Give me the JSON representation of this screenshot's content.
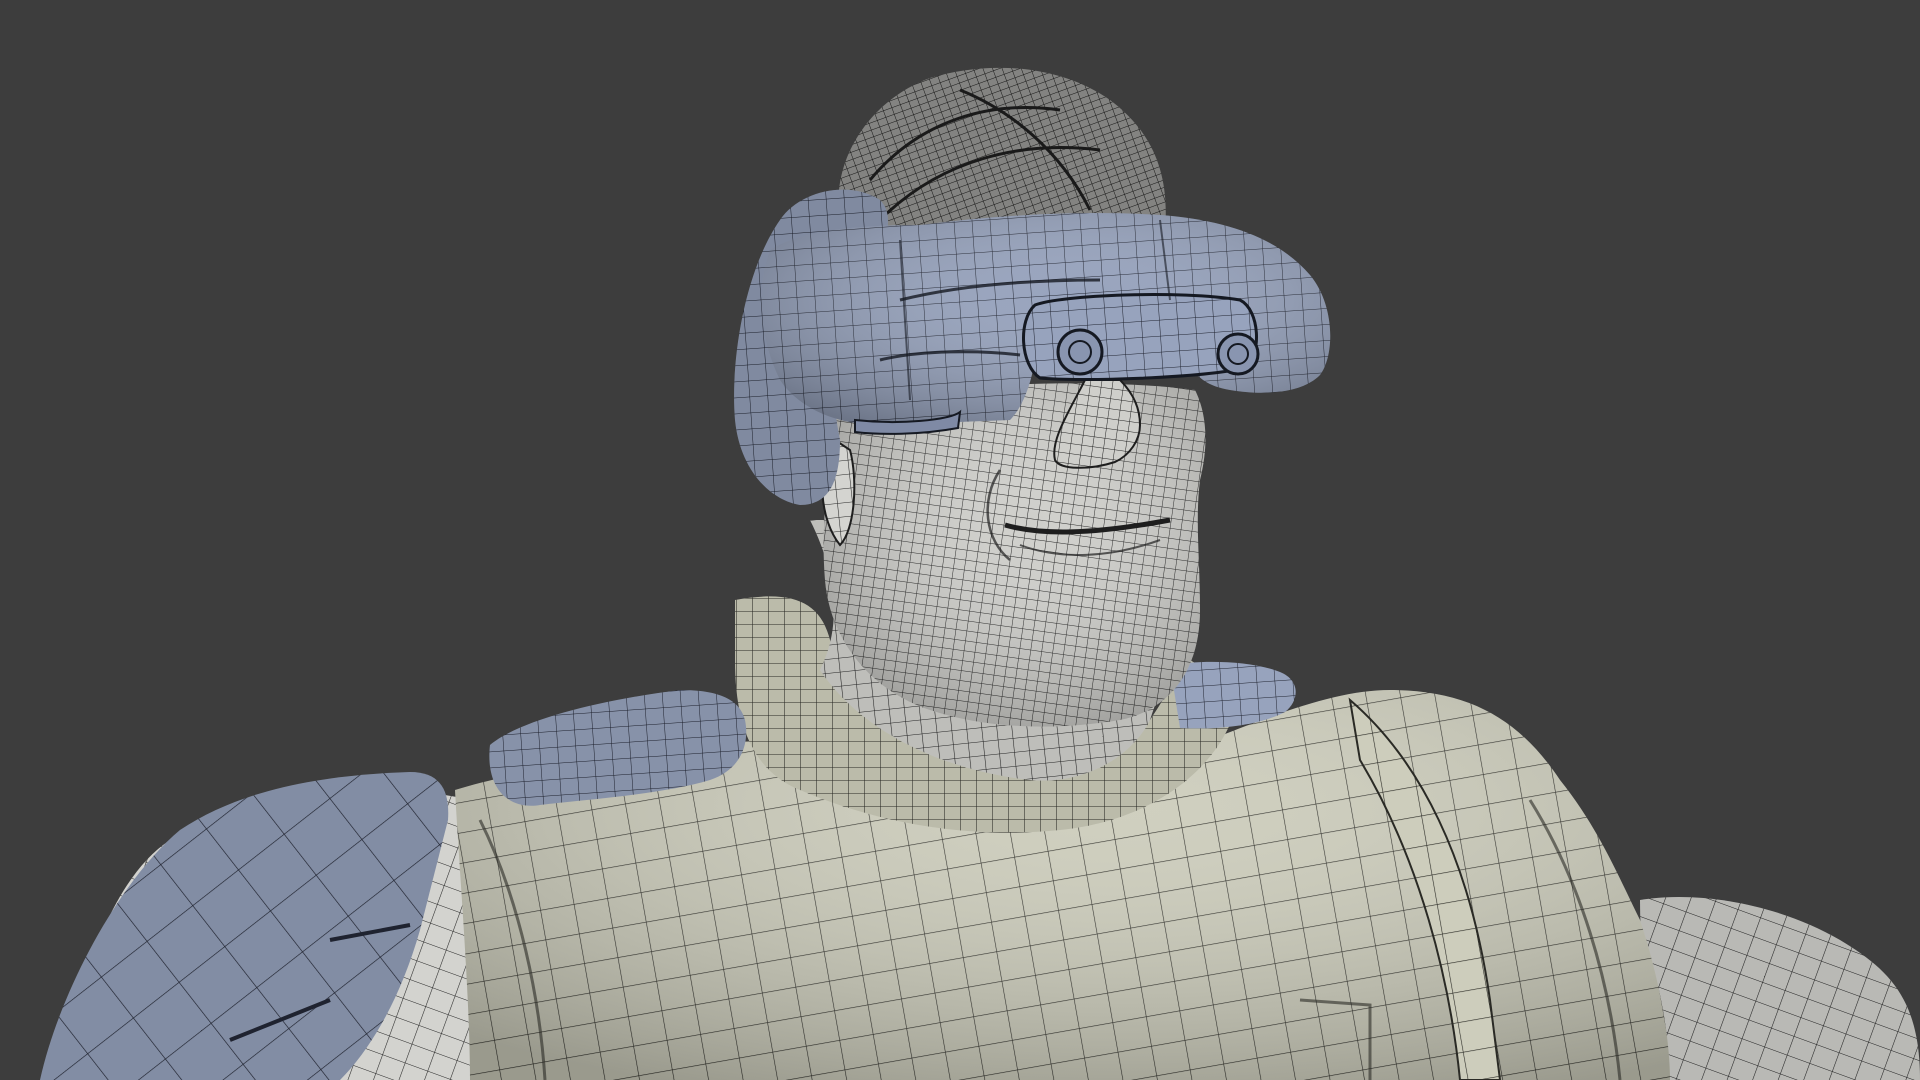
{
  "viewport": {
    "background": "#3d3d3d",
    "shading": "solid-with-wireframe-overlay"
  },
  "colors": {
    "skin": "#d6d6d2",
    "vest": "#cfcfbd",
    "armor": "#96a2bc",
    "armor_dark": "#7c88a3",
    "hair": "#9a9a97",
    "wire": "#1a1a1a"
  },
  "scene": {
    "object": "character-bust-mesh",
    "parts": [
      "hair",
      "visor-helmet",
      "head",
      "neck",
      "vest",
      "shoulder-pads",
      "arm-armor",
      "right-arm"
    ]
  }
}
